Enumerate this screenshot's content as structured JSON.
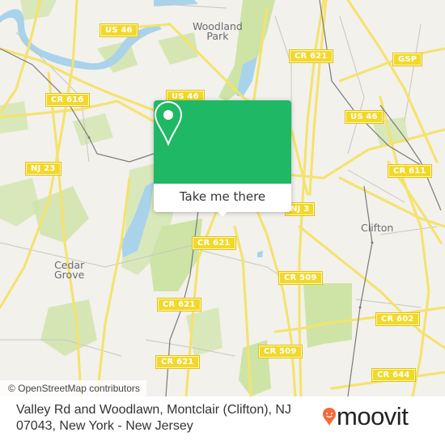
{
  "map": {
    "attribution": "© OpenStreetMap contributors",
    "colors": {
      "land": "#f2f1ec",
      "park": "#cde4a6",
      "water": "#a8d3ea",
      "road_major": "#f5e26a",
      "road_minor": "#c8c6c2",
      "rail": "#7a7a7a",
      "shield": "#f2d82a"
    },
    "place_labels": [
      {
        "name": "woodland-park",
        "lines": [
          "Woodland",
          "Park"
        ]
      },
      {
        "name": "cedar-grove",
        "lines": [
          "Cedar",
          "Grove"
        ]
      },
      {
        "name": "clifton",
        "lines": [
          "Clifton"
        ]
      }
    ],
    "road_shields": [
      {
        "id": "us46-a",
        "label": "US 46"
      },
      {
        "id": "us46-b",
        "label": "US 46"
      },
      {
        "id": "us46-c",
        "label": "US 46"
      },
      {
        "id": "us46-d",
        "label": "US 46"
      },
      {
        "id": "cr621-a",
        "label": "CR 621"
      },
      {
        "id": "cr621-b",
        "label": "CR 621"
      },
      {
        "id": "cr621-c",
        "label": "CR 621"
      },
      {
        "id": "cr621-d",
        "label": "CR 621"
      },
      {
        "id": "cr616",
        "label": "CR 616"
      },
      {
        "id": "gsp",
        "label": "GSP"
      },
      {
        "id": "cr611",
        "label": "CR 611"
      },
      {
        "id": "nj23",
        "label": "NJ 23"
      },
      {
        "id": "nj3",
        "label": "NJ 3"
      },
      {
        "id": "cr509-a",
        "label": "CR 509"
      },
      {
        "id": "cr509-b",
        "label": "CR 509"
      },
      {
        "id": "cr602",
        "label": "CR 602"
      },
      {
        "id": "cr644",
        "label": "CR 644"
      }
    ]
  },
  "popup": {
    "button_label": "Take me there",
    "icon": "map-pin-icon",
    "color": "#1fb865"
  },
  "footer": {
    "address_line1": "Valley Rd and Woodlawn, Montclair (Clifton), NJ",
    "address_line2": "07043, New York - New Jersey",
    "logo_text": "moovit",
    "logo_color": "#f26b3a"
  }
}
